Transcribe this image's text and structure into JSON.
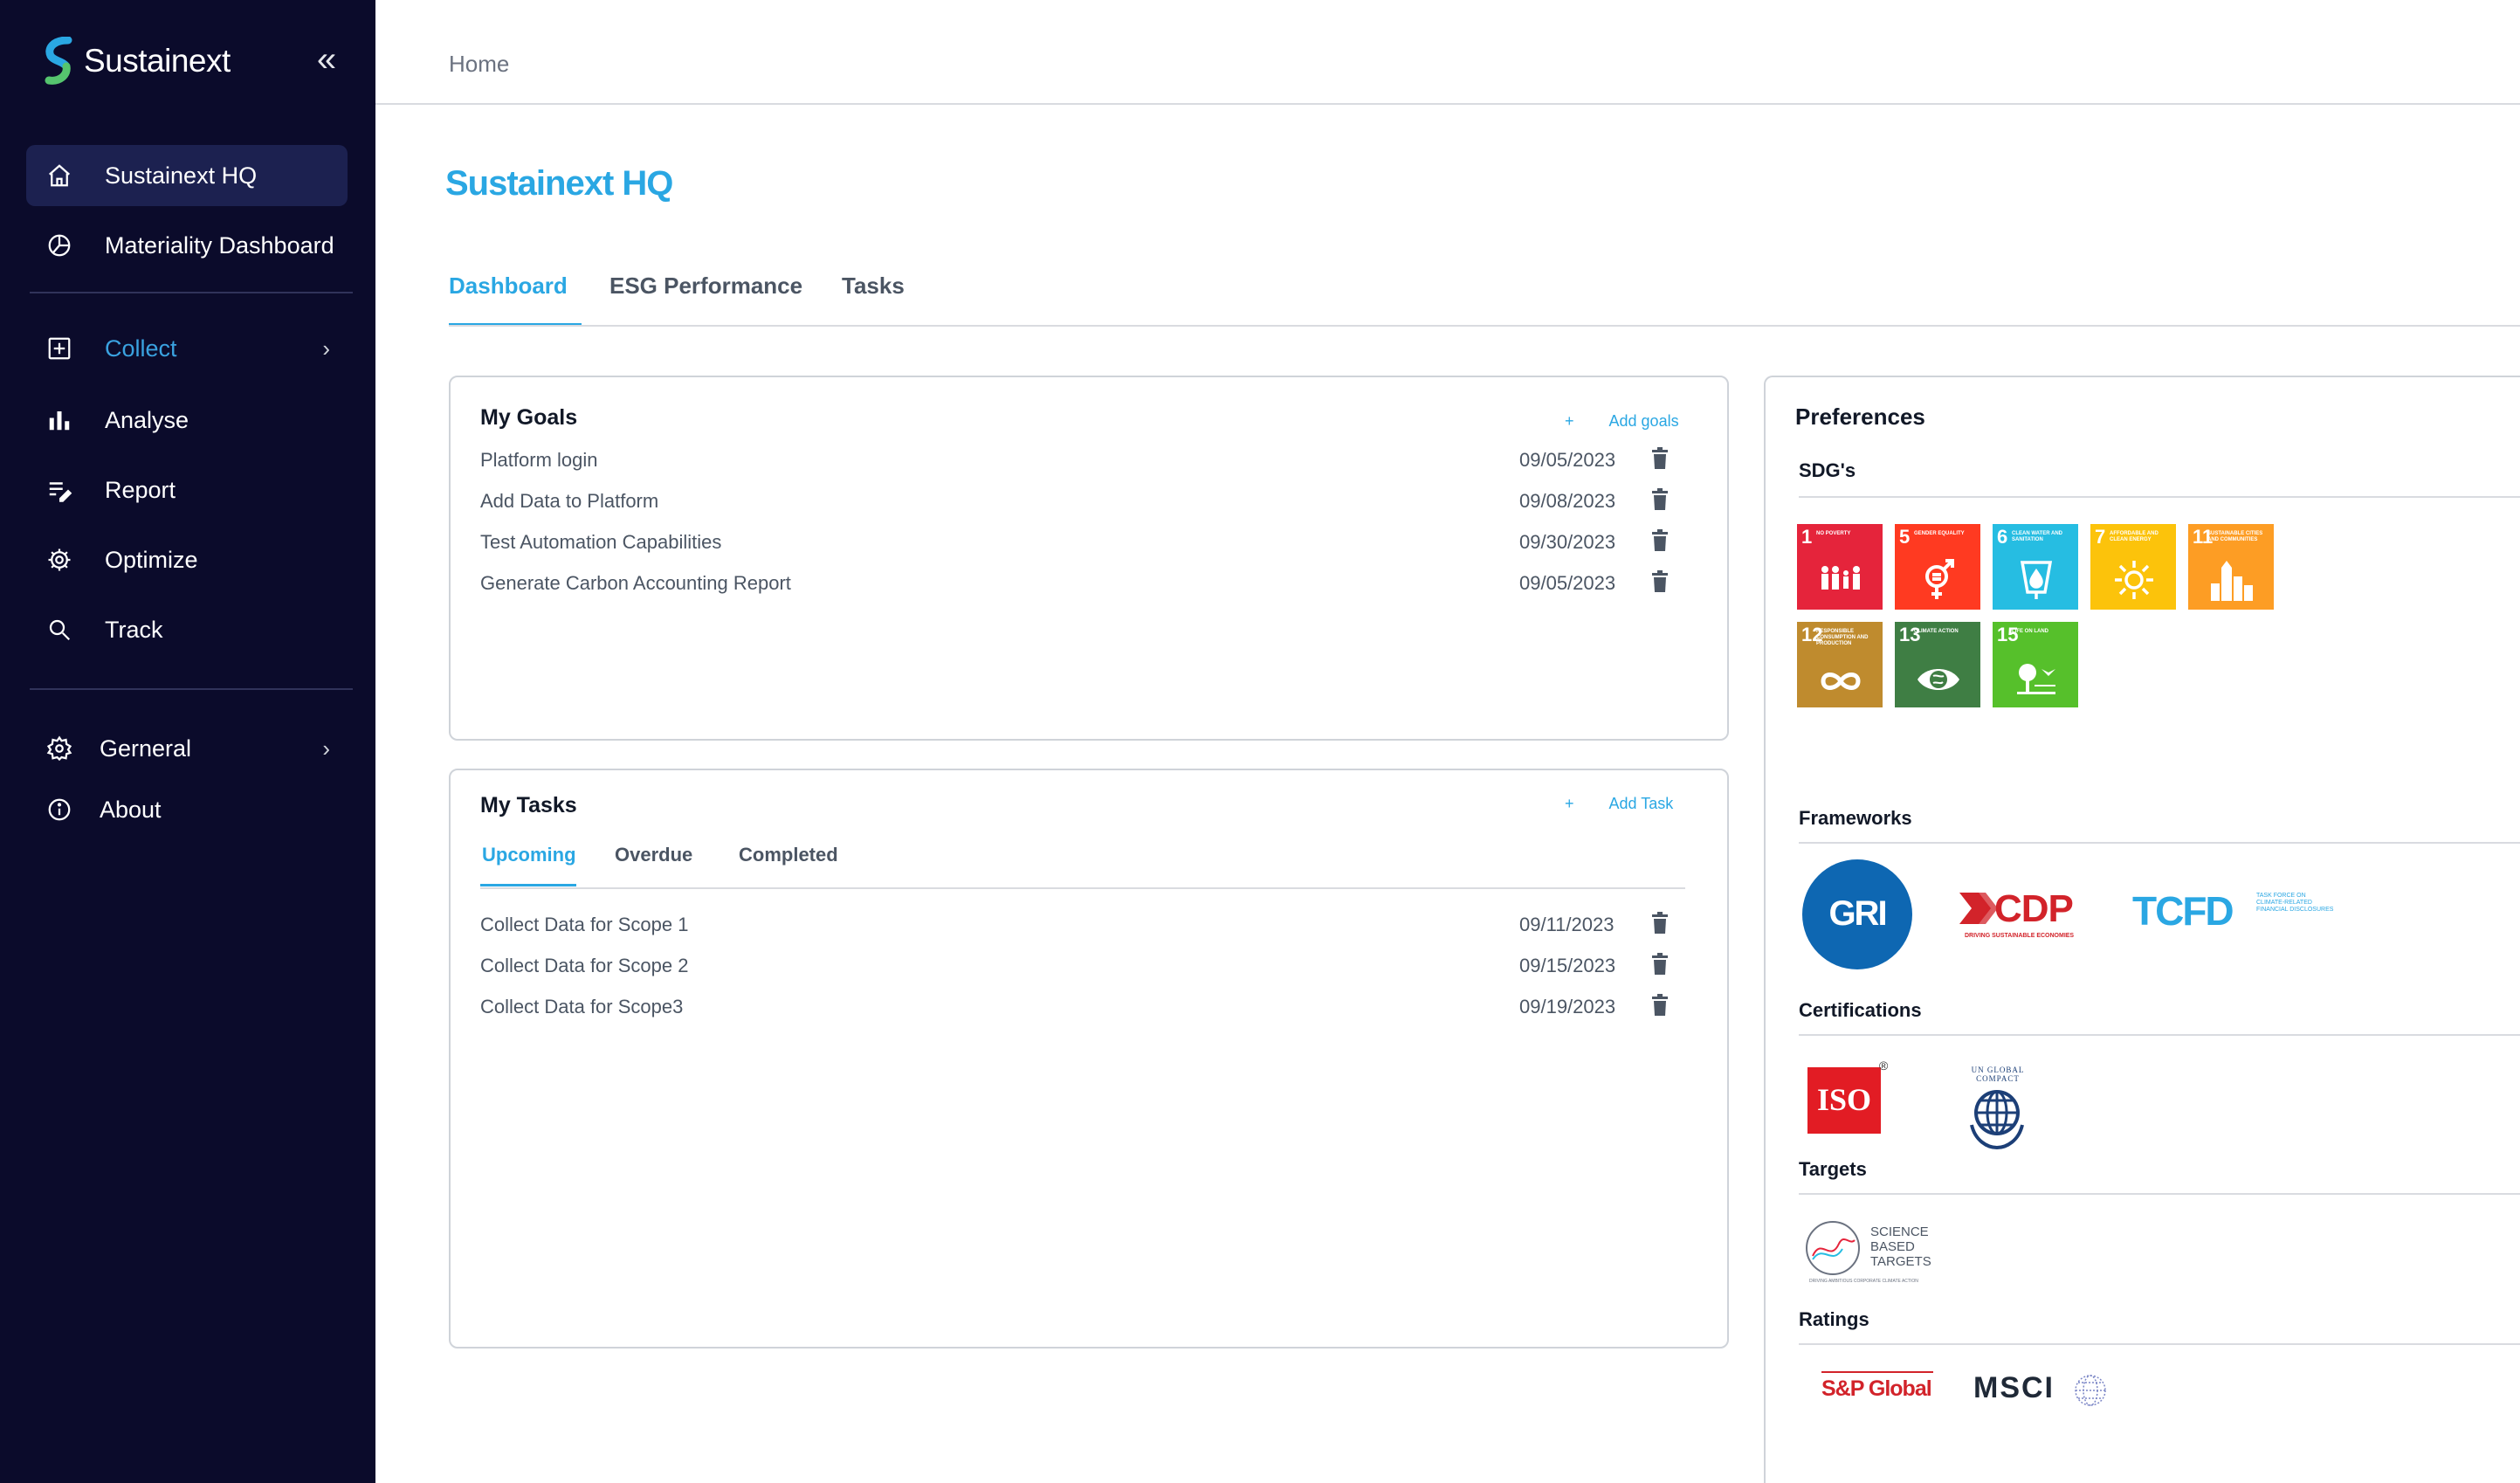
{
  "app": {
    "brand": "Sustainext"
  },
  "sidebar": {
    "items": [
      {
        "label": "Sustainext HQ",
        "icon": "home-icon"
      },
      {
        "label": "Materiality Dashboard",
        "icon": "pie-chart-icon"
      },
      {
        "label": "Collect",
        "icon": "plus-square-icon"
      },
      {
        "label": "Analyse",
        "icon": "bar-chart-icon"
      },
      {
        "label": "Report",
        "icon": "report-edit-icon"
      },
      {
        "label": "Optimize",
        "icon": "gear-settings-icon"
      },
      {
        "label": "Track",
        "icon": "search-icon"
      },
      {
        "label": "Gerneral",
        "icon": "gear-icon"
      },
      {
        "label": "About",
        "icon": "info-icon"
      }
    ],
    "chevron": "›",
    "collapse": "«"
  },
  "breadcrumb": "Home",
  "page_title": "Sustainext HQ",
  "tabs": [
    "Dashboard",
    "ESG Performance",
    "Tasks"
  ],
  "goals": {
    "title": "My Goals",
    "add_plus": "+",
    "add_label": "Add goals",
    "rows": [
      {
        "text": "Platform login",
        "date": "09/05/2023"
      },
      {
        "text": "Add Data to Platform",
        "date": "09/08/2023"
      },
      {
        "text": "Test Automation Capabilities",
        "date": "09/30/2023"
      },
      {
        "text": "Generate Carbon Accounting Report",
        "date": "09/05/2023"
      }
    ]
  },
  "tasks": {
    "title": "My Tasks",
    "add_plus": "+",
    "add_label": "Add Task",
    "subtabs": [
      "Upcoming",
      "Overdue",
      "Completed"
    ],
    "rows": [
      {
        "text": "Collect Data for Scope 1",
        "date": "09/11/2023"
      },
      {
        "text": "Collect Data for Scope 2",
        "date": "09/15/2023"
      },
      {
        "text": "Collect Data for Scope3",
        "date": "09/19/2023"
      }
    ]
  },
  "preferences": {
    "title": "Preferences",
    "sdg_label": "SDG's",
    "sdgs": [
      {
        "num": "1",
        "text": "NO POVERTY",
        "color": "#e5243b"
      },
      {
        "num": "5",
        "text": "GENDER EQUALITY",
        "color": "#ff3a21"
      },
      {
        "num": "6",
        "text": "CLEAN WATER AND SANITATION",
        "color": "#26bde2"
      },
      {
        "num": "7",
        "text": "AFFORDABLE AND CLEAN ENERGY",
        "color": "#fcc30b"
      },
      {
        "num": "11",
        "text": "SUSTAINABLE CITIES AND COMMUNITIES",
        "color": "#fd9d24"
      },
      {
        "num": "12",
        "text": "RESPONSIBLE CONSUMPTION AND PRODUCTION",
        "color": "#bf8b2e"
      },
      {
        "num": "13",
        "text": "CLIMATE ACTION",
        "color": "#3f7e44"
      },
      {
        "num": "15",
        "text": "LIFE ON LAND",
        "color": "#56c02b"
      }
    ],
    "frameworks_label": "Frameworks",
    "frameworks": {
      "gri": "GRI",
      "cdp": "CDP",
      "cdp_tag": "DRIVING SUSTAINABLE ECONOMIES",
      "tcfd": "TCFD",
      "tcfd_tag": "TASK FORCE ON CLIMATE-RELATED FINANCIAL DISCLOSURES"
    },
    "certifications_label": "Certifications",
    "certifications": {
      "iso": "ISO",
      "iso_mark": "®",
      "ungc": "UN GLOBAL COMPACT"
    },
    "targets_label": "Targets",
    "targets": {
      "sbt_line1": "SCIENCE",
      "sbt_line2": "BASED",
      "sbt_line3": "TARGETS",
      "sbt_tag": "DRIVING AMBITIOUS CORPORATE CLIMATE ACTION"
    },
    "ratings_label": "Ratings",
    "ratings": {
      "sp": "S&P Global",
      "msci": "MSCI"
    }
  },
  "colors": {
    "accent": "#2aa7e3",
    "sidebar_bg": "#0b0b2b",
    "sidebar_active": "#1c2150"
  }
}
